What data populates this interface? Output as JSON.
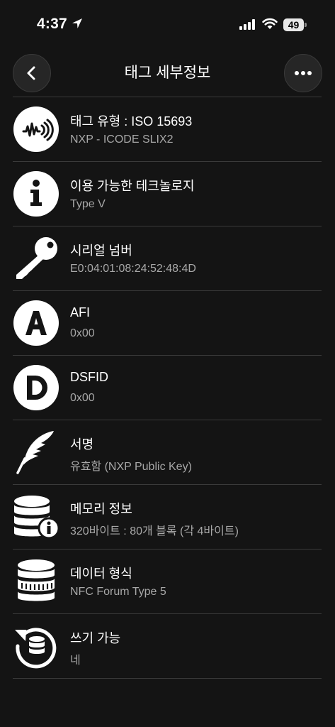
{
  "status": {
    "time": "4:37",
    "battery": "49"
  },
  "nav": {
    "title": "태그 세부정보"
  },
  "rows": [
    {
      "title": "태그 유형 : ISO 15693",
      "subtitle": "NXP - ICODE SLIX2",
      "icon": "nfc-tag-icon"
    },
    {
      "title": "이용 가능한 테크놀로지",
      "subtitle": "Type V",
      "icon": "info-icon"
    },
    {
      "title": "시리얼 넘버",
      "subtitle": "E0:04:01:08:24:52:48:4D",
      "icon": "key-icon"
    },
    {
      "title": "AFI",
      "subtitle": "0x00",
      "icon": "letter-a-icon"
    },
    {
      "title": "DSFID",
      "subtitle": "0x00",
      "icon": "letter-d-icon"
    },
    {
      "title": "서명",
      "subtitle": "유효함 (NXP Public Key)",
      "icon": "feather-icon"
    },
    {
      "title": "메모리 정보",
      "subtitle": "320바이트 : 80개 블록 (각 4바이트)",
      "icon": "database-info-icon"
    },
    {
      "title": "데이터 형식",
      "subtitle": "NFC Forum Type 5",
      "icon": "data-format-icon"
    },
    {
      "title": "쓰기 가능",
      "subtitle": "네",
      "icon": "writable-icon"
    }
  ]
}
